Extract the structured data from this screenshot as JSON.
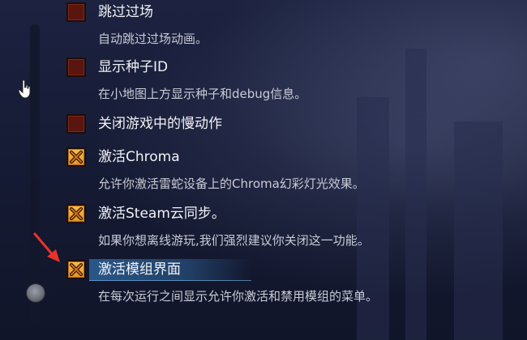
{
  "options": [
    {
      "label": "跳过过场",
      "description": "自动跳过过场动画。",
      "checked": false
    },
    {
      "label": "显示种子ID",
      "description": "在小地图上方显示种子和debug信息。",
      "checked": false
    },
    {
      "label": "关闭游戏中的慢动作",
      "description": "",
      "checked": false
    },
    {
      "label": "激活Chroma",
      "description": "允许你激活雷蛇设备上的Chroma幻彩灯光效果。",
      "checked": true
    },
    {
      "label": "激活Steam云同步。",
      "description": "如果你想离线游玩,我们强烈建议你关闭这一功能。",
      "checked": true
    },
    {
      "label": "激活模组界面",
      "description": "在每次运行之间显示允许你激活和禁用模组的菜单。",
      "checked": true,
      "focused": true
    }
  ],
  "colors": {
    "checked_fill": "#f3c24a",
    "unchecked_fill": "#5a150e",
    "focus_highlight": "#3c8cd2",
    "annotation_arrow": "#e8332a"
  },
  "icons": [
    "hand-pointer-cursor-icon",
    "red-annotation-arrow-icon",
    "scrollbar-knob-icon",
    "checkbox-x-icon"
  ]
}
